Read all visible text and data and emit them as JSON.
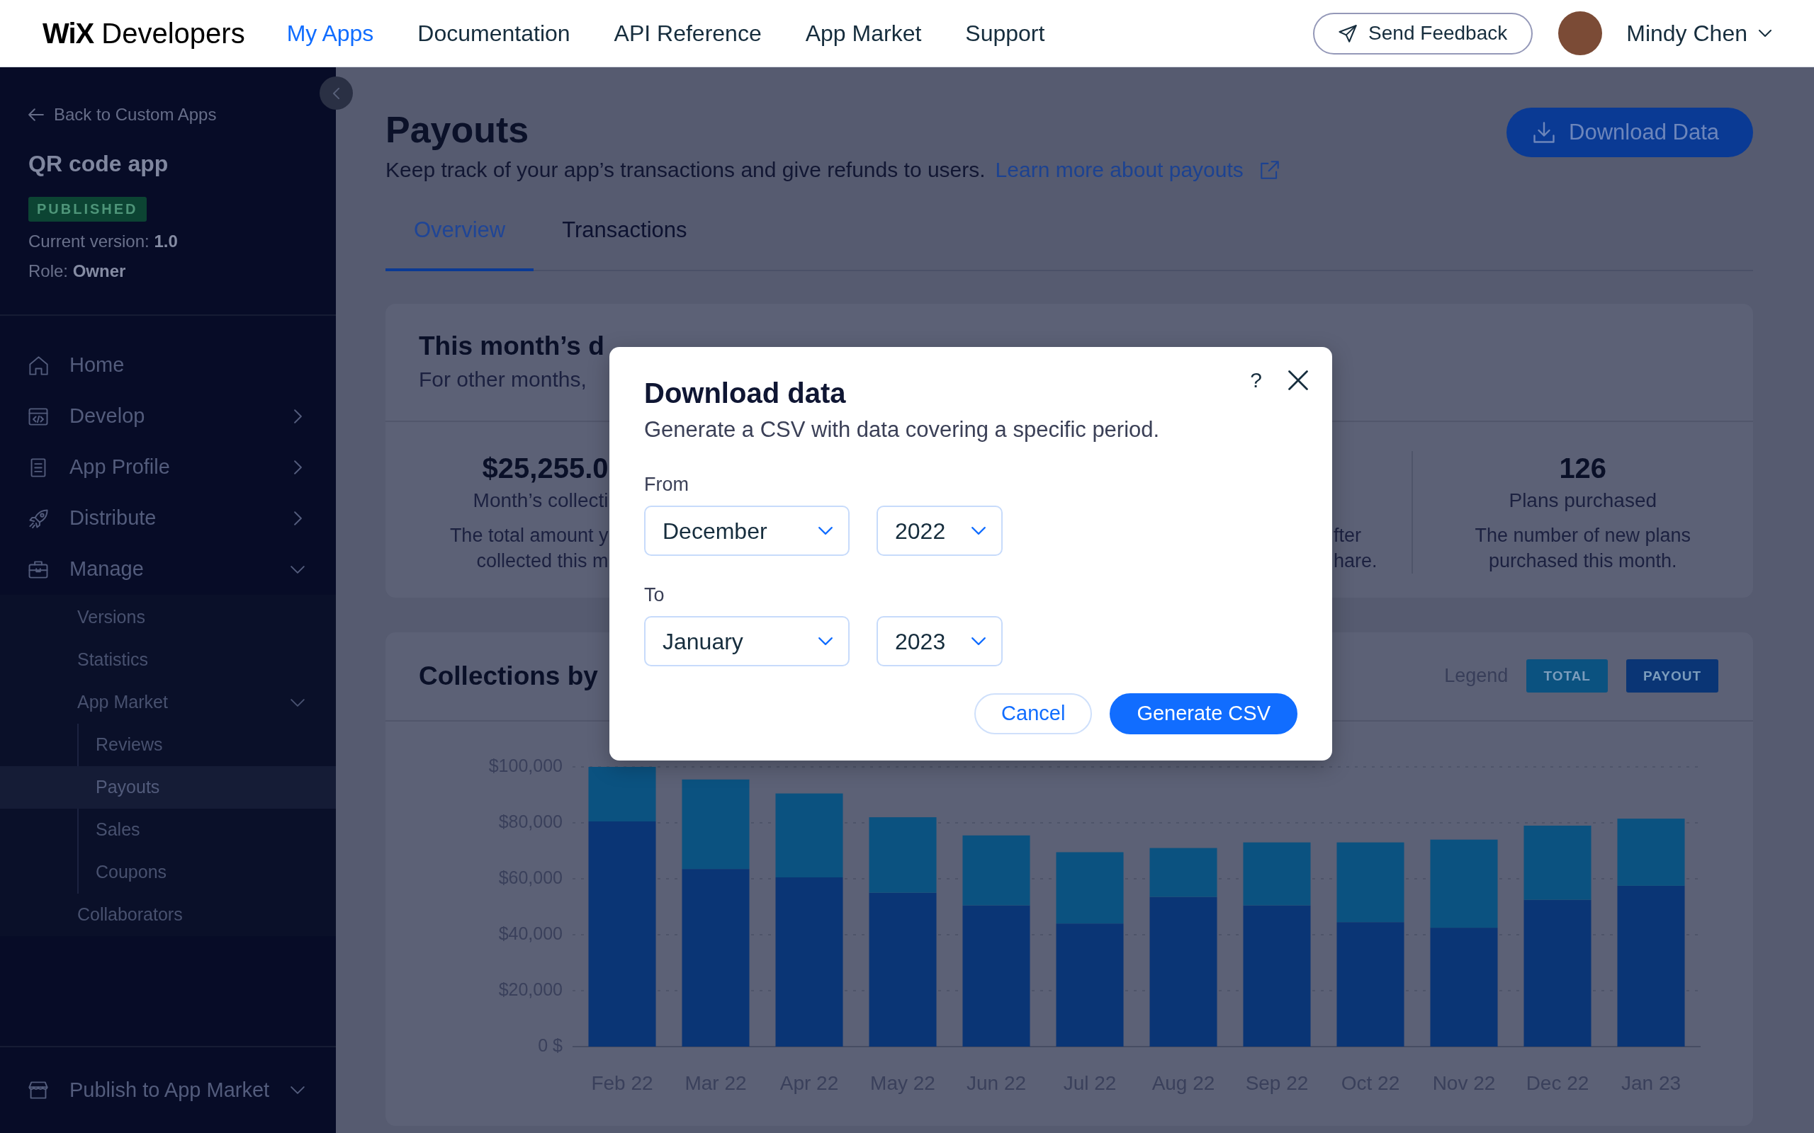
{
  "top_nav": {
    "logo": "**WiX** Developers",
    "links": [
      {
        "label": "My Apps",
        "selected": true
      },
      {
        "label": "Documentation",
        "selected": false
      },
      {
        "label": "API Reference",
        "selected": false
      },
      {
        "label": "App Market",
        "selected": false
      },
      {
        "label": "Support",
        "selected": false
      }
    ],
    "feedback_button": "Send Feedback",
    "user_name": "Mindy Chen"
  },
  "sidebar": {
    "back_link": "Back to Custom Apps",
    "app_name": "QR code app",
    "status_badge": "PUBLISHED",
    "details": [
      "Current version: **1.0**",
      "Role: **Owner**"
    ],
    "items": [
      {
        "label": "Home",
        "selected": false
      },
      {
        "label": "Develop",
        "selected": false,
        "expanded": false
      },
      {
        "label": "App Profile",
        "selected": false,
        "expanded": false
      },
      {
        "label": "Distribute",
        "selected": false,
        "expanded": false
      },
      {
        "label": "Manage",
        "selected": false,
        "expanded": true,
        "children": [
          {
            "label": "Versions",
            "selected": false
          },
          {
            "label": "Statistics",
            "selected": false
          },
          {
            "label": "App Market",
            "selected": false,
            "expanded": true,
            "children": [
              {
                "label": "Reviews",
                "selected": false
              },
              {
                "label": "Payouts",
                "selected": true
              },
              {
                "label": "Sales",
                "selected": false
              },
              {
                "label": "Coupons",
                "selected": false
              }
            ]
          },
          {
            "label": "Collaborators",
            "selected": false
          }
        ]
      }
    ],
    "footer_item": "Publish to App Market"
  },
  "main": {
    "title": "Payouts",
    "subtitle": "Keep track of your app’s transactions and give refunds to users.",
    "learn_more_link": "Learn more about payouts",
    "download_button": "Download Data",
    "tabs": [
      {
        "label": "Overview",
        "selected": true
      },
      {
        "label": "Transactions",
        "selected": false
      }
    ],
    "summary_card": {
      "title": "This month’s d",
      "subtitle": "For other months,",
      "stats": [
        {
          "kind": "clipped_end",
          "value": "$25,255.0",
          "label": "Month’s collecti",
          "description_lines": [
            "The total amount y",
            "collected this m"
          ]
        },
        {
          "kind": "clipped_start",
          "description_lines": [
            "fter",
            "hare."
          ]
        },
        {
          "kind": "whole",
          "value": "126",
          "label": "Plans purchased",
          "description": "The number of new plans purchased this month."
        }
      ]
    },
    "chart_card": {
      "title": "Collections by",
      "legend_label": "Legend",
      "chart_data": {
        "type": "bar",
        "categories": [
          "Feb 22",
          "Mar 22",
          "Apr 22",
          "May 22",
          "Jun 22",
          "Jul 22",
          "Aug 22",
          "Sep 22",
          "Oct 22",
          "Nov 22",
          "Dec 22",
          "Jan 23"
        ],
        "series": [
          {
            "name": "TOTAL",
            "color": "#0b5280",
            "values": [
              19500,
              32000,
              30000,
              27000,
              25000,
              25500,
              17500,
              22500,
              28500,
              31500,
              26500,
              24000
            ]
          },
          {
            "name": "PAYOUT",
            "color": "#0a3575",
            "values": [
              80500,
              63500,
              60500,
              55000,
              50500,
              44000,
              53500,
              50500,
              44500,
              42500,
              52500,
              57500
            ]
          }
        ],
        "ylim": [
          0,
          100000
        ],
        "yticks": [
          {
            "value": 0,
            "label": "0 $"
          },
          {
            "value": 20000,
            "label": "$20,000"
          },
          {
            "value": 40000,
            "label": "$40,000"
          },
          {
            "value": 60000,
            "label": "$60,000"
          },
          {
            "value": 80000,
            "label": "$80,000"
          },
          {
            "value": 100000,
            "label": "$100,000"
          }
        ],
        "stacked": true,
        "grid": true
      }
    }
  },
  "dialog": {
    "title": "Download data",
    "subtitle": "Generate a CSV with data covering a specific period.",
    "help_button": "?",
    "ranges": [
      {
        "label": "From",
        "month": "December",
        "year": "2022"
      },
      {
        "label": "To",
        "month": "January",
        "year": "2023"
      }
    ],
    "buttons": [
      {
        "label": "Cancel",
        "kind": "secondary"
      },
      {
        "label": "Generate CSV",
        "kind": "primary"
      }
    ]
  }
}
